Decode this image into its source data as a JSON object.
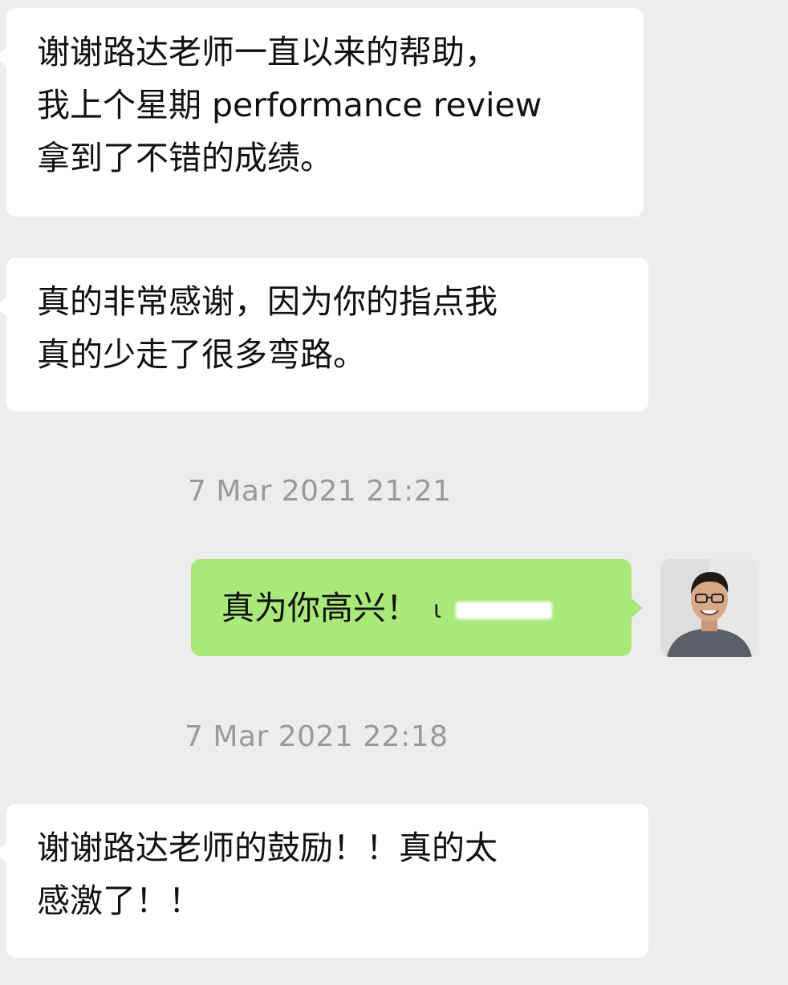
{
  "messages": [
    {
      "lines": [
        "谢谢路达老师一直以来的帮助，",
        "我上个星期 performance review",
        "拿到了不错的成绩。"
      ]
    },
    {
      "lines": [
        "真的非常感谢，因为你的指点我",
        "真的少走了很多弯路。"
      ]
    },
    {
      "timestamp": "7 Mar 2021 21:21"
    },
    {
      "text": "真为你高兴！",
      "tick": "ι"
    },
    {
      "timestamp": "7 Mar 2021 22:18"
    },
    {
      "lines": [
        "谢谢路达老师的鼓励！！真的太",
        "感激了！！"
      ]
    }
  ],
  "colors": {
    "background": "#ededed",
    "incoming_bubble": "#ffffff",
    "outgoing_bubble": "#a9e97a",
    "timestamp_text": "#9a9a9a"
  },
  "icons": {
    "avatar": "avatar-photo"
  }
}
